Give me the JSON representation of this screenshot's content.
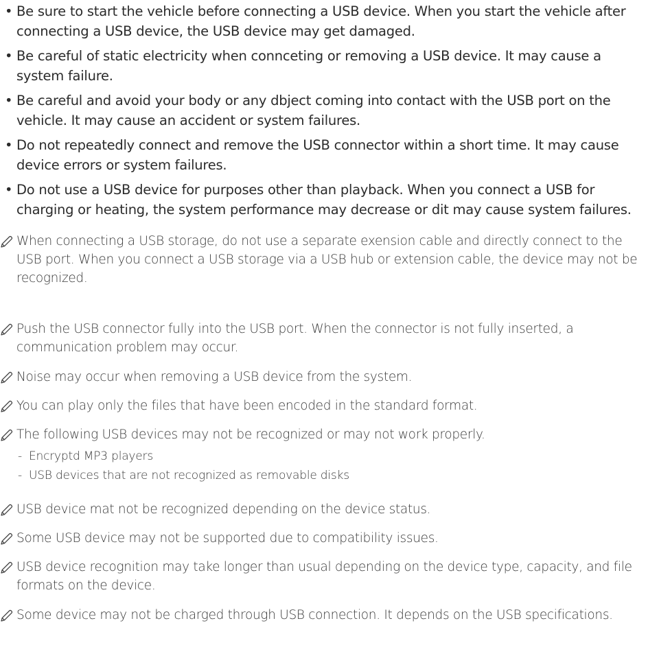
{
  "cautions": [
    "Be sure to start the vehicle before connecting a USB device. When you start the vehicle after connecting a USB device, the USB device may get damaged.",
    "Be careful of static electricity when connceting or removing a USB device. It may cause a system failure.",
    "Be careful and avoid your body or any dbject coming into contact with the USB port on the vehicle. It may cause an accident or system failures.",
    "Do not repeatedly connect and remove the USB connector within a short time. It may cause device errors or system failures.",
    "Do not use a USB device for purposes other than playback. When you connect a USB for charging or heating, the system performance may decrease or dit may cause system failures."
  ],
  "bullet_glyph": "•",
  "notes": [
    {
      "text": "When connecting a USB storage, do not use a separate exension cable and directly connect to the USB port. When you connect a USB storage via a USB hub or extension cable, the device may not be recognized."
    },
    {
      "text": "Push the USB connector fully into the USB port. When the connector is not fully inserted, a communication problem may occur."
    },
    {
      "text": "Noise may occur when removing a USB device from the system."
    },
    {
      "text": "You can play only the files that have been encoded in the standard format."
    },
    {
      "text": "The following USB devices may not be recognized or may not work properly.",
      "sub_items": [
        "Encryptd MP3 players",
        "USB devices that are not recognized as removable disks"
      ]
    },
    {
      "text": "USB device mat not be recognized depending on the device status."
    },
    {
      "text": "Some USB device may not be supported due to compatibility issues."
    },
    {
      "text": "USB device recognition may take longer than usual depending on the device type, capacity, and file formats on the device."
    },
    {
      "text": "Some device may not be charged through USB connection. It depends on the USB specifications."
    }
  ],
  "sub_item_glyph": "-",
  "note_icon": "pencil-icon",
  "colors": {
    "text": "#2b2b2b",
    "note_text": "#3a3a3a",
    "background": "#ffffff"
  }
}
